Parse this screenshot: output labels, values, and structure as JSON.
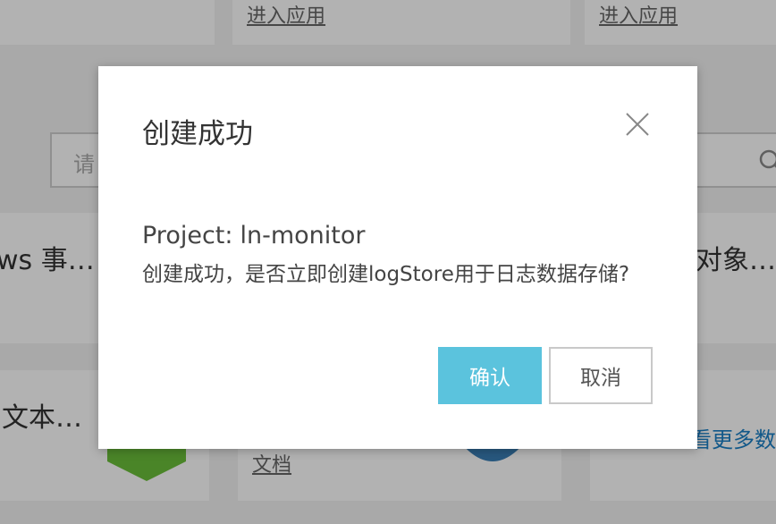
{
  "background": {
    "cards": [
      {
        "link": "进入应用"
      },
      {
        "link": "进入应用"
      }
    ],
    "search": {
      "placeholder": "请"
    },
    "tiles": [
      {
        "title": "ws 事…"
      },
      {
        "title": "对象…"
      },
      {
        "title": "文本…"
      },
      {
        "link": "文档"
      },
      {
        "link": "看更多数据"
      }
    ]
  },
  "dialog": {
    "title": "创建成功",
    "project_label": "Project:",
    "project_name": "ln-monitor",
    "message": "创建成功，是否立即创建logStore用于日志数据存储?",
    "confirm_label": "确认",
    "cancel_label": "取消"
  },
  "colors": {
    "primary_button": "#5bc3dd",
    "link_blue": "#1a7fc4",
    "overlay": "rgba(0,0,0,0.30)"
  },
  "icons": [
    "close-icon",
    "search-icon"
  ]
}
